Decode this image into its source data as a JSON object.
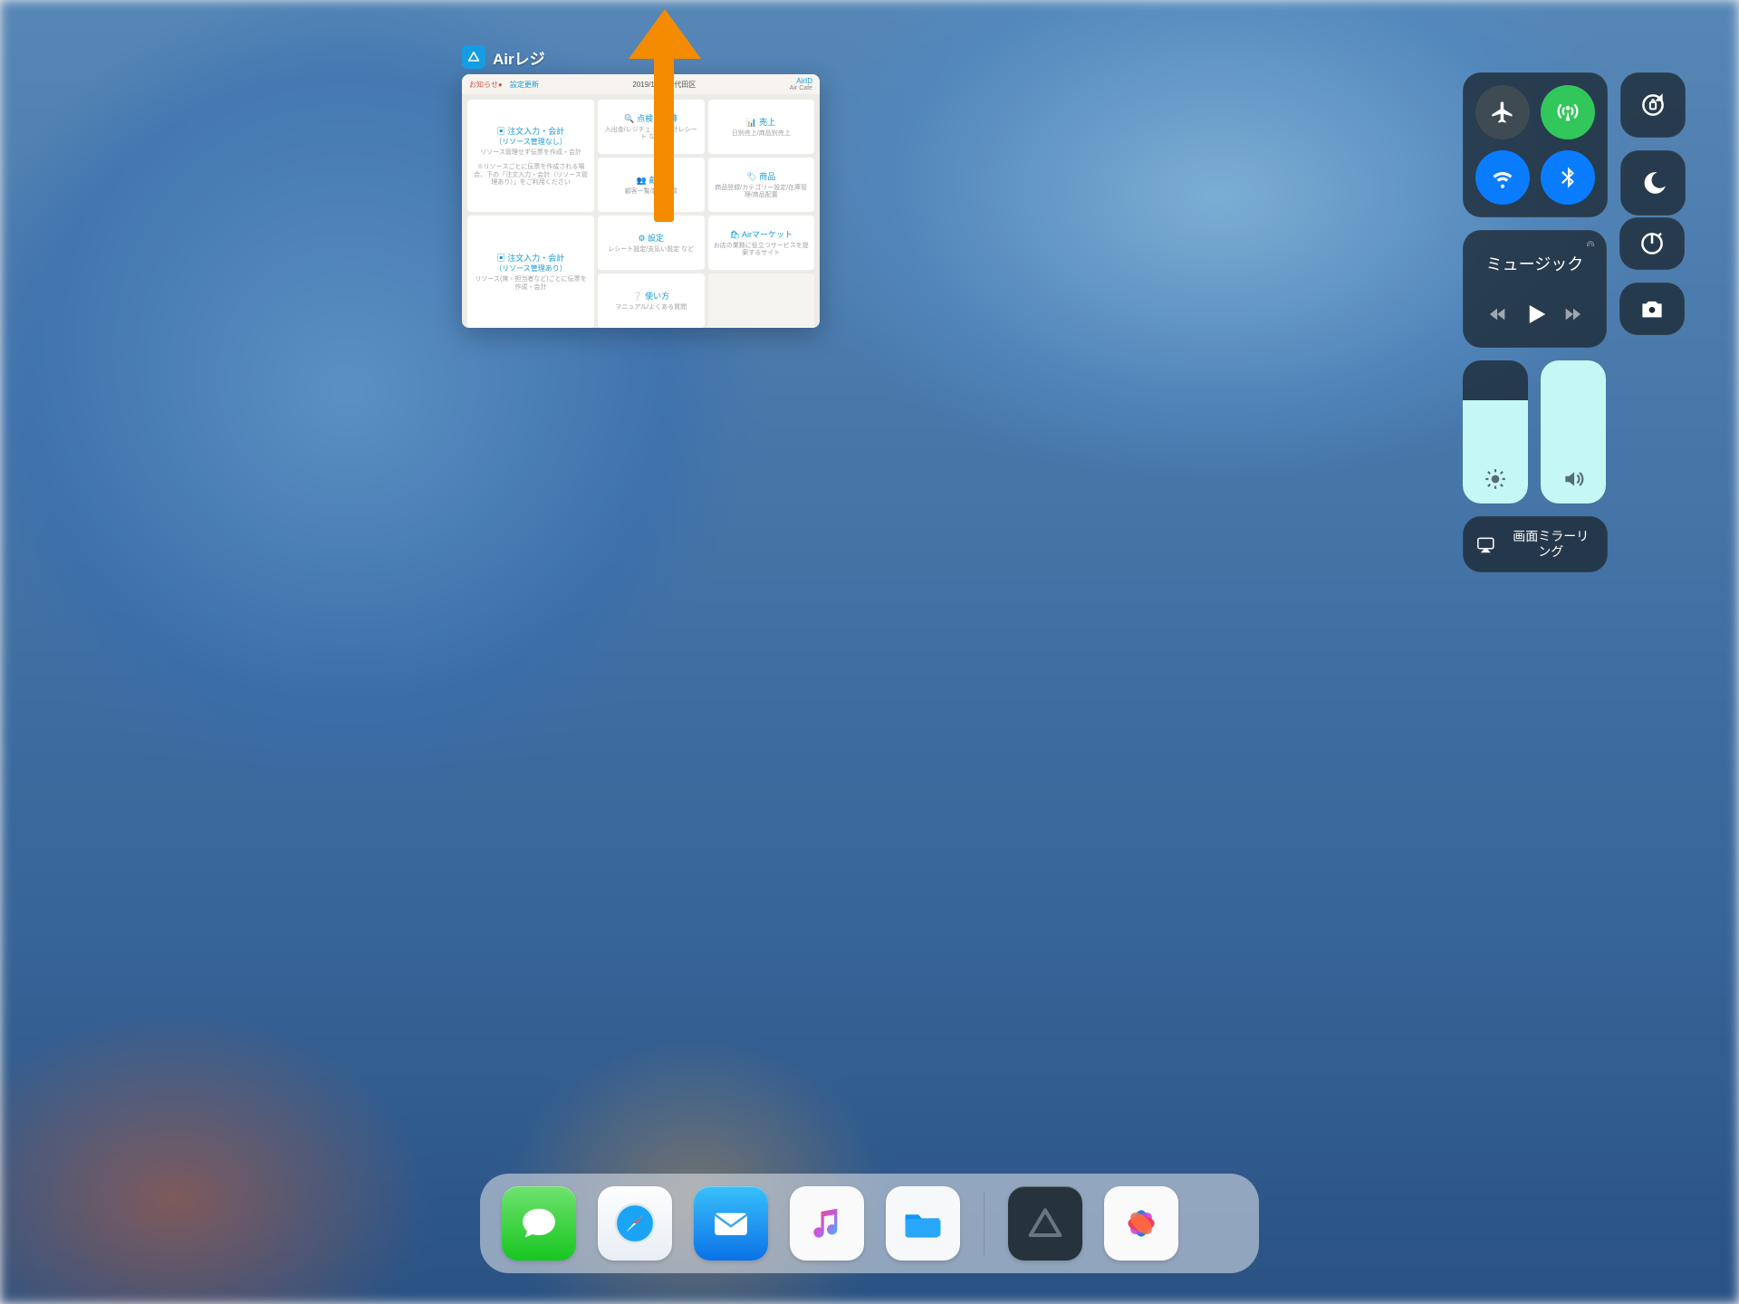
{
  "appSwitcher": {
    "app_name": "Airレジ",
    "thumb": {
      "header_left_notice": "お知らせ",
      "header_left_badge": "●",
      "header_left_update": "設定更新",
      "header_center": "2019/1/17    千代田区",
      "header_right_top": "AirID",
      "header_right_bottom": "Air Cafe",
      "tiles": [
        {
          "t": "注文入力・会計",
          "s": "（リソース管理なし）",
          "d": "リソース管理せず伝票を作成・会計"
        },
        {
          "t": "点検・精算",
          "d": "入出金/レジチェック/日計レシート など"
        },
        {
          "t": "売上",
          "d": "日別売上/商品別売上"
        },
        {
          "t": "顧客",
          "d": "顧客一覧/新規登録"
        },
        {
          "t": "商品",
          "d": "商品登録/カテゴリー設定/在庫管理/商品配置"
        },
        {
          "t": "注文入力・会計",
          "s": "（リソース管理あり）",
          "d": "リソース(席・担当者など)ごとに伝票を作成・会計"
        },
        {
          "t": "設定",
          "d": "レシート設定/支払い設定 など"
        },
        {
          "t": "Airマーケット",
          "d": "お店の業務に役立つサービスを提案するサイト"
        },
        {
          "t": "使い方",
          "d": "マニュアル/よくある質問"
        }
      ]
    }
  },
  "controlCenter": {
    "music_label": "ミュージック",
    "mirror_label": "画面ミラーリング",
    "brightness_pct": 72,
    "volume_pct": 100,
    "toggles": {
      "airplane_on": false,
      "cellular_on": true,
      "wifi_on": true,
      "bluetooth_on": true
    }
  },
  "dock": {
    "apps": [
      "メッセージ",
      "Safari",
      "メール",
      "ミュージック",
      "ファイル",
      "Airレジ",
      "写真"
    ]
  },
  "annotation": {
    "direction": "上方向スワイプ"
  }
}
